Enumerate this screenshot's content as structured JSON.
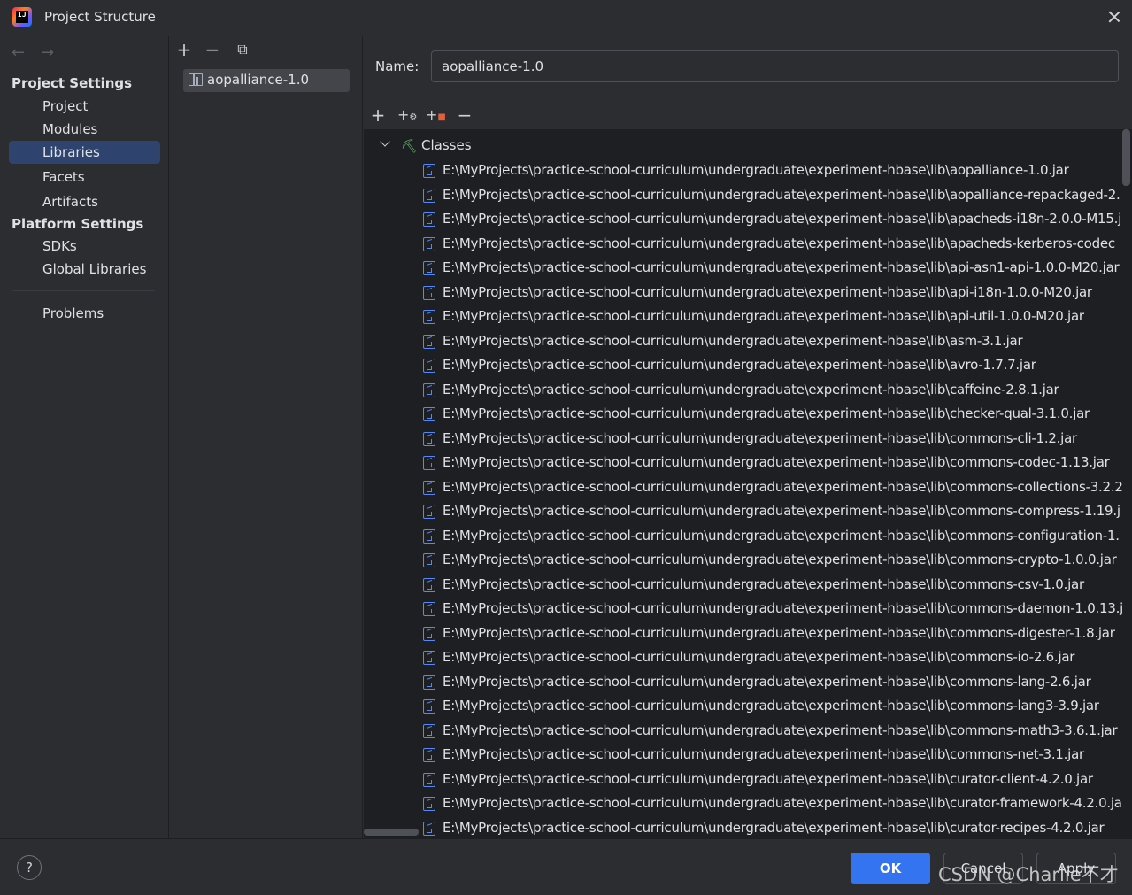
{
  "window": {
    "title": "Project Structure"
  },
  "nav": {
    "project_settings_header": "Project Settings",
    "platform_settings_header": "Platform Settings",
    "items": {
      "project": "Project",
      "modules": "Modules",
      "libraries": "Libraries",
      "facets": "Facets",
      "artifacts": "Artifacts",
      "sdks": "SDKs",
      "global_libraries": "Global Libraries",
      "problems": "Problems"
    },
    "selected": "Libraries"
  },
  "libraries_panel": {
    "items": [
      "aopalliance-1.0"
    ],
    "selected": "aopalliance-1.0"
  },
  "detail": {
    "name_label": "Name:",
    "name_value": "aopalliance-1.0",
    "tree": {
      "root_label": "Classes",
      "expanded": true,
      "jars": [
        "E:\\MyProjects\\practice-school-curriculum\\undergraduate\\experiment-hbase\\lib\\aopalliance-1.0.jar",
        "E:\\MyProjects\\practice-school-curriculum\\undergraduate\\experiment-hbase\\lib\\aopalliance-repackaged-2.",
        "E:\\MyProjects\\practice-school-curriculum\\undergraduate\\experiment-hbase\\lib\\apacheds-i18n-2.0.0-M15.j",
        "E:\\MyProjects\\practice-school-curriculum\\undergraduate\\experiment-hbase\\lib\\apacheds-kerberos-codec",
        "E:\\MyProjects\\practice-school-curriculum\\undergraduate\\experiment-hbase\\lib\\api-asn1-api-1.0.0-M20.jar",
        "E:\\MyProjects\\practice-school-curriculum\\undergraduate\\experiment-hbase\\lib\\api-i18n-1.0.0-M20.jar",
        "E:\\MyProjects\\practice-school-curriculum\\undergraduate\\experiment-hbase\\lib\\api-util-1.0.0-M20.jar",
        "E:\\MyProjects\\practice-school-curriculum\\undergraduate\\experiment-hbase\\lib\\asm-3.1.jar",
        "E:\\MyProjects\\practice-school-curriculum\\undergraduate\\experiment-hbase\\lib\\avro-1.7.7.jar",
        "E:\\MyProjects\\practice-school-curriculum\\undergraduate\\experiment-hbase\\lib\\caffeine-2.8.1.jar",
        "E:\\MyProjects\\practice-school-curriculum\\undergraduate\\experiment-hbase\\lib\\checker-qual-3.1.0.jar",
        "E:\\MyProjects\\practice-school-curriculum\\undergraduate\\experiment-hbase\\lib\\commons-cli-1.2.jar",
        "E:\\MyProjects\\practice-school-curriculum\\undergraduate\\experiment-hbase\\lib\\commons-codec-1.13.jar",
        "E:\\MyProjects\\practice-school-curriculum\\undergraduate\\experiment-hbase\\lib\\commons-collections-3.2.2",
        "E:\\MyProjects\\practice-school-curriculum\\undergraduate\\experiment-hbase\\lib\\commons-compress-1.19.j",
        "E:\\MyProjects\\practice-school-curriculum\\undergraduate\\experiment-hbase\\lib\\commons-configuration-1.",
        "E:\\MyProjects\\practice-school-curriculum\\undergraduate\\experiment-hbase\\lib\\commons-crypto-1.0.0.jar",
        "E:\\MyProjects\\practice-school-curriculum\\undergraduate\\experiment-hbase\\lib\\commons-csv-1.0.jar",
        "E:\\MyProjects\\practice-school-curriculum\\undergraduate\\experiment-hbase\\lib\\commons-daemon-1.0.13.j",
        "E:\\MyProjects\\practice-school-curriculum\\undergraduate\\experiment-hbase\\lib\\commons-digester-1.8.jar",
        "E:\\MyProjects\\practice-school-curriculum\\undergraduate\\experiment-hbase\\lib\\commons-io-2.6.jar",
        "E:\\MyProjects\\practice-school-curriculum\\undergraduate\\experiment-hbase\\lib\\commons-lang-2.6.jar",
        "E:\\MyProjects\\practice-school-curriculum\\undergraduate\\experiment-hbase\\lib\\commons-lang3-3.9.jar",
        "E:\\MyProjects\\practice-school-curriculum\\undergraduate\\experiment-hbase\\lib\\commons-math3-3.6.1.jar",
        "E:\\MyProjects\\practice-school-curriculum\\undergraduate\\experiment-hbase\\lib\\commons-net-3.1.jar",
        "E:\\MyProjects\\practice-school-curriculum\\undergraduate\\experiment-hbase\\lib\\curator-client-4.2.0.jar",
        "E:\\MyProjects\\practice-school-curriculum\\undergraduate\\experiment-hbase\\lib\\curator-framework-4.2.0.ja",
        "E:\\MyProjects\\practice-school-curriculum\\undergraduate\\experiment-hbase\\lib\\curator-recipes-4.2.0.jar"
      ]
    }
  },
  "buttons": {
    "ok": "OK",
    "cancel": "Cancel",
    "apply": "Apply",
    "help": "?"
  },
  "watermark": "CSDN @Charlie不才",
  "icons": {
    "app": "intellij-idea-icon",
    "back": "back-arrow-icon",
    "forward": "forward-arrow-icon",
    "close": "close-icon",
    "add": "plus-icon",
    "remove": "minus-icon",
    "copy": "copy-icon",
    "library": "library-icon",
    "classes": "classes-icon",
    "jar": "jar-icon"
  },
  "colors": {
    "accent": "#3574f0",
    "selection": "#2e436e",
    "background": "#2b2d30",
    "tree_bg": "#1e1f22"
  }
}
